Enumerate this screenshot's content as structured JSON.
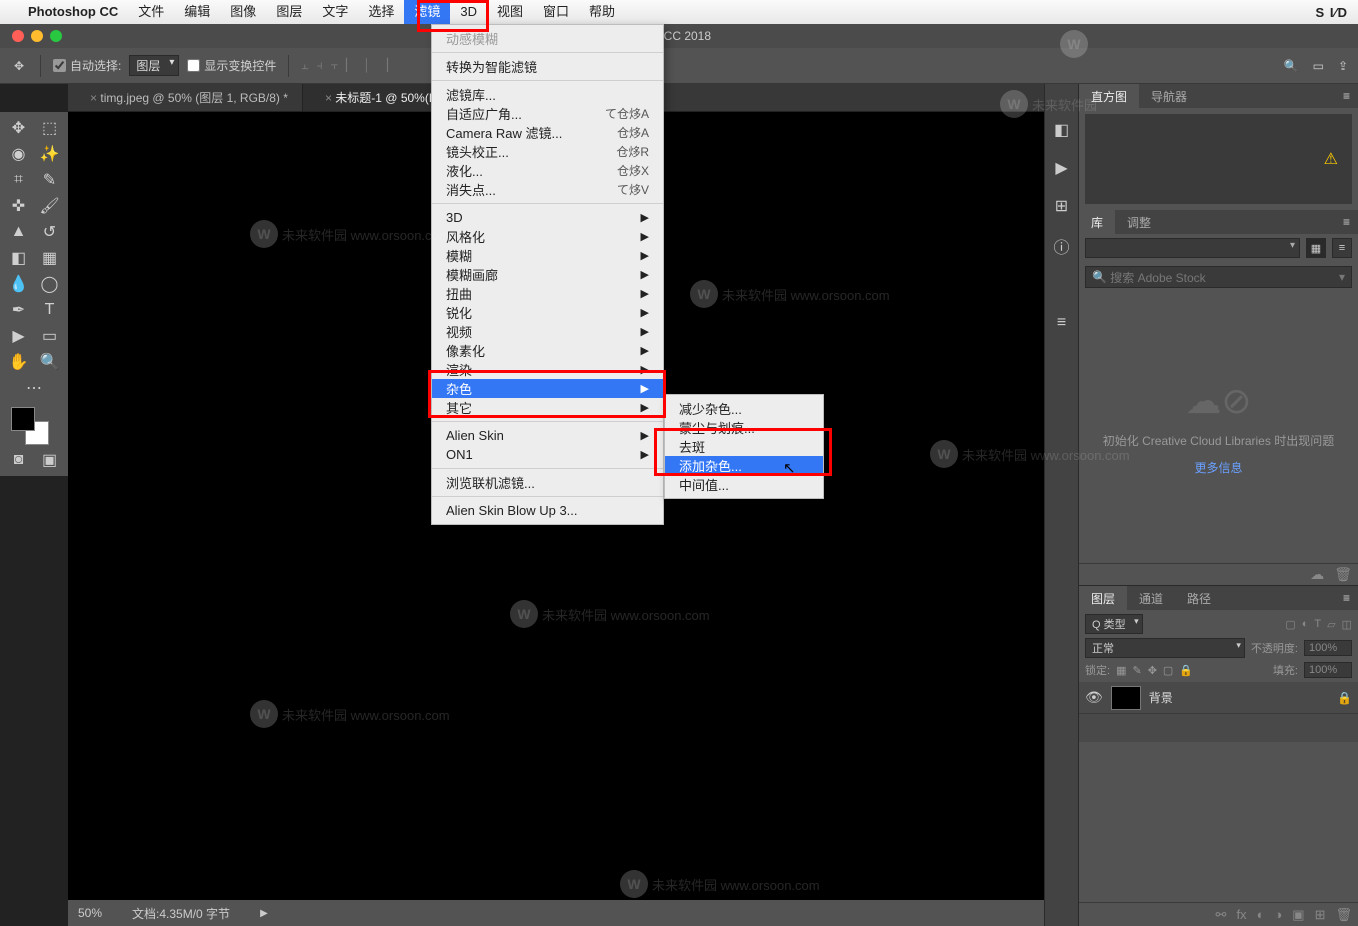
{
  "menubar": {
    "app": "Photoshop CC",
    "items": [
      "文件",
      "编辑",
      "图像",
      "图层",
      "文字",
      "选择",
      "滤镜",
      "3D",
      "视图",
      "窗口",
      "帮助"
    ],
    "right": "S  I⁄D"
  },
  "window": {
    "title": "op CC 2018"
  },
  "options": {
    "auto_select_label": "自动选择:",
    "auto_select_value": "图层",
    "transform_label": "显示变换控件"
  },
  "tabs": [
    {
      "label": "timg.jpeg @ 50% (图层 1, RGB/8) *",
      "active": false
    },
    {
      "label": "未标题-1 @ 50%(RG",
      "active": true
    }
  ],
  "status": {
    "zoom": "50%",
    "doc": "文档:4.35M/0 字节"
  },
  "filter_menu": {
    "last": "动感模糊",
    "convert": "转换为智能滤镜",
    "gallery": "滤镜库...",
    "adaptive": "自适应广角...",
    "adaptive_sc": "て仓㶴A",
    "cameraraw": "Camera Raw 滤镜...",
    "cameraraw_sc": "仓㶴A",
    "lens": "镜头校正...",
    "lens_sc": "仓㶴R",
    "liquify": "液化...",
    "liquify_sc": "仓㶴X",
    "vanish": "消失点...",
    "vanish_sc": "て㶴V",
    "three_d": "3D",
    "stylize": "风格化",
    "blur": "模糊",
    "blurgallery": "模糊画廊",
    "distort": "扭曲",
    "sharpen": "锐化",
    "video": "视频",
    "pixelate": "像素化",
    "render": "渲染",
    "noise": "杂色",
    "other": "其它",
    "alien": "Alien Skin",
    "on1": "ON1",
    "browse": "浏览联机滤镜...",
    "blowup": "Alien Skin Blow Up 3..."
  },
  "noise_submenu": {
    "reduce": "减少杂色...",
    "dust": "蒙尘与划痕...",
    "despeckle": "去斑",
    "add": "添加杂色...",
    "median": "中间值..."
  },
  "panels": {
    "histogram": "直方图",
    "navigator": "导航器",
    "library": "库",
    "adjustments": "调整",
    "search_placeholder": "搜索 Adobe Stock",
    "lib_msg": "初始化 Creative Cloud Libraries 时出现问题",
    "more_info": "更多信息",
    "layers": "图层",
    "channels": "通道",
    "paths": "路径",
    "kind": "Q 类型",
    "normal": "正常",
    "opacity_label": "不透明度:",
    "opacity_val": "100%",
    "lock_label": "锁定:",
    "fill_label": "填充:",
    "fill_val": "100%",
    "layer_name": "背景"
  }
}
